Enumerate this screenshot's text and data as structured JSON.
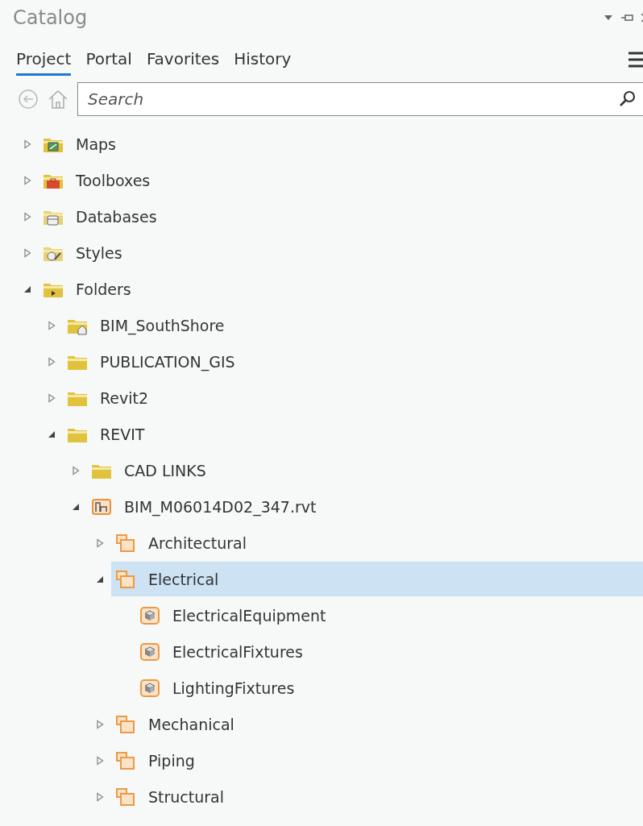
{
  "window": {
    "title": "Catalog"
  },
  "tabs": [
    {
      "label": "Project",
      "selected": true
    },
    {
      "label": "Portal",
      "selected": false
    },
    {
      "label": "Favorites",
      "selected": false
    },
    {
      "label": "History",
      "selected": false
    }
  ],
  "search": {
    "placeholder": "Search"
  },
  "tree": [
    {
      "label": "Maps",
      "kind": "map",
      "expanded": false,
      "selected": false
    },
    {
      "label": "Toolboxes",
      "kind": "toolbox",
      "expanded": false,
      "selected": false
    },
    {
      "label": "Databases",
      "kind": "database",
      "expanded": false,
      "selected": false
    },
    {
      "label": "Styles",
      "kind": "style",
      "expanded": false,
      "selected": false
    },
    {
      "label": "Folders",
      "kind": "folders",
      "expanded": true,
      "selected": false,
      "children": [
        {
          "label": "BIM_SouthShore",
          "kind": "home-folder",
          "expanded": false,
          "selected": false
        },
        {
          "label": "PUBLICATION_GIS",
          "kind": "folder",
          "expanded": false,
          "selected": false
        },
        {
          "label": "Revit2",
          "kind": "folder",
          "expanded": false,
          "selected": false
        },
        {
          "label": "REVIT",
          "kind": "folder",
          "expanded": true,
          "selected": false,
          "children": [
            {
              "label": "CAD LINKS",
              "kind": "folder",
              "expanded": false,
              "selected": false
            },
            {
              "label": "BIM_M06014D02_347.rvt",
              "kind": "revit-file",
              "expanded": true,
              "selected": false,
              "children": [
                {
                  "label": "Architectural",
                  "kind": "category",
                  "expanded": false,
                  "selected": false
                },
                {
                  "label": "Electrical",
                  "kind": "category",
                  "expanded": true,
                  "selected": true,
                  "children": [
                    {
                      "label": "ElectricalEquipment",
                      "kind": "layer",
                      "selected": false
                    },
                    {
                      "label": "ElectricalFixtures",
                      "kind": "layer",
                      "selected": false
                    },
                    {
                      "label": "LightingFixtures",
                      "kind": "layer",
                      "selected": false
                    }
                  ]
                },
                {
                  "label": "Mechanical",
                  "kind": "category",
                  "expanded": false,
                  "selected": false
                },
                {
                  "label": "Piping",
                  "kind": "category",
                  "expanded": false,
                  "selected": false
                },
                {
                  "label": "Structural",
                  "kind": "category",
                  "expanded": false,
                  "selected": false
                }
              ]
            }
          ]
        }
      ]
    }
  ]
}
